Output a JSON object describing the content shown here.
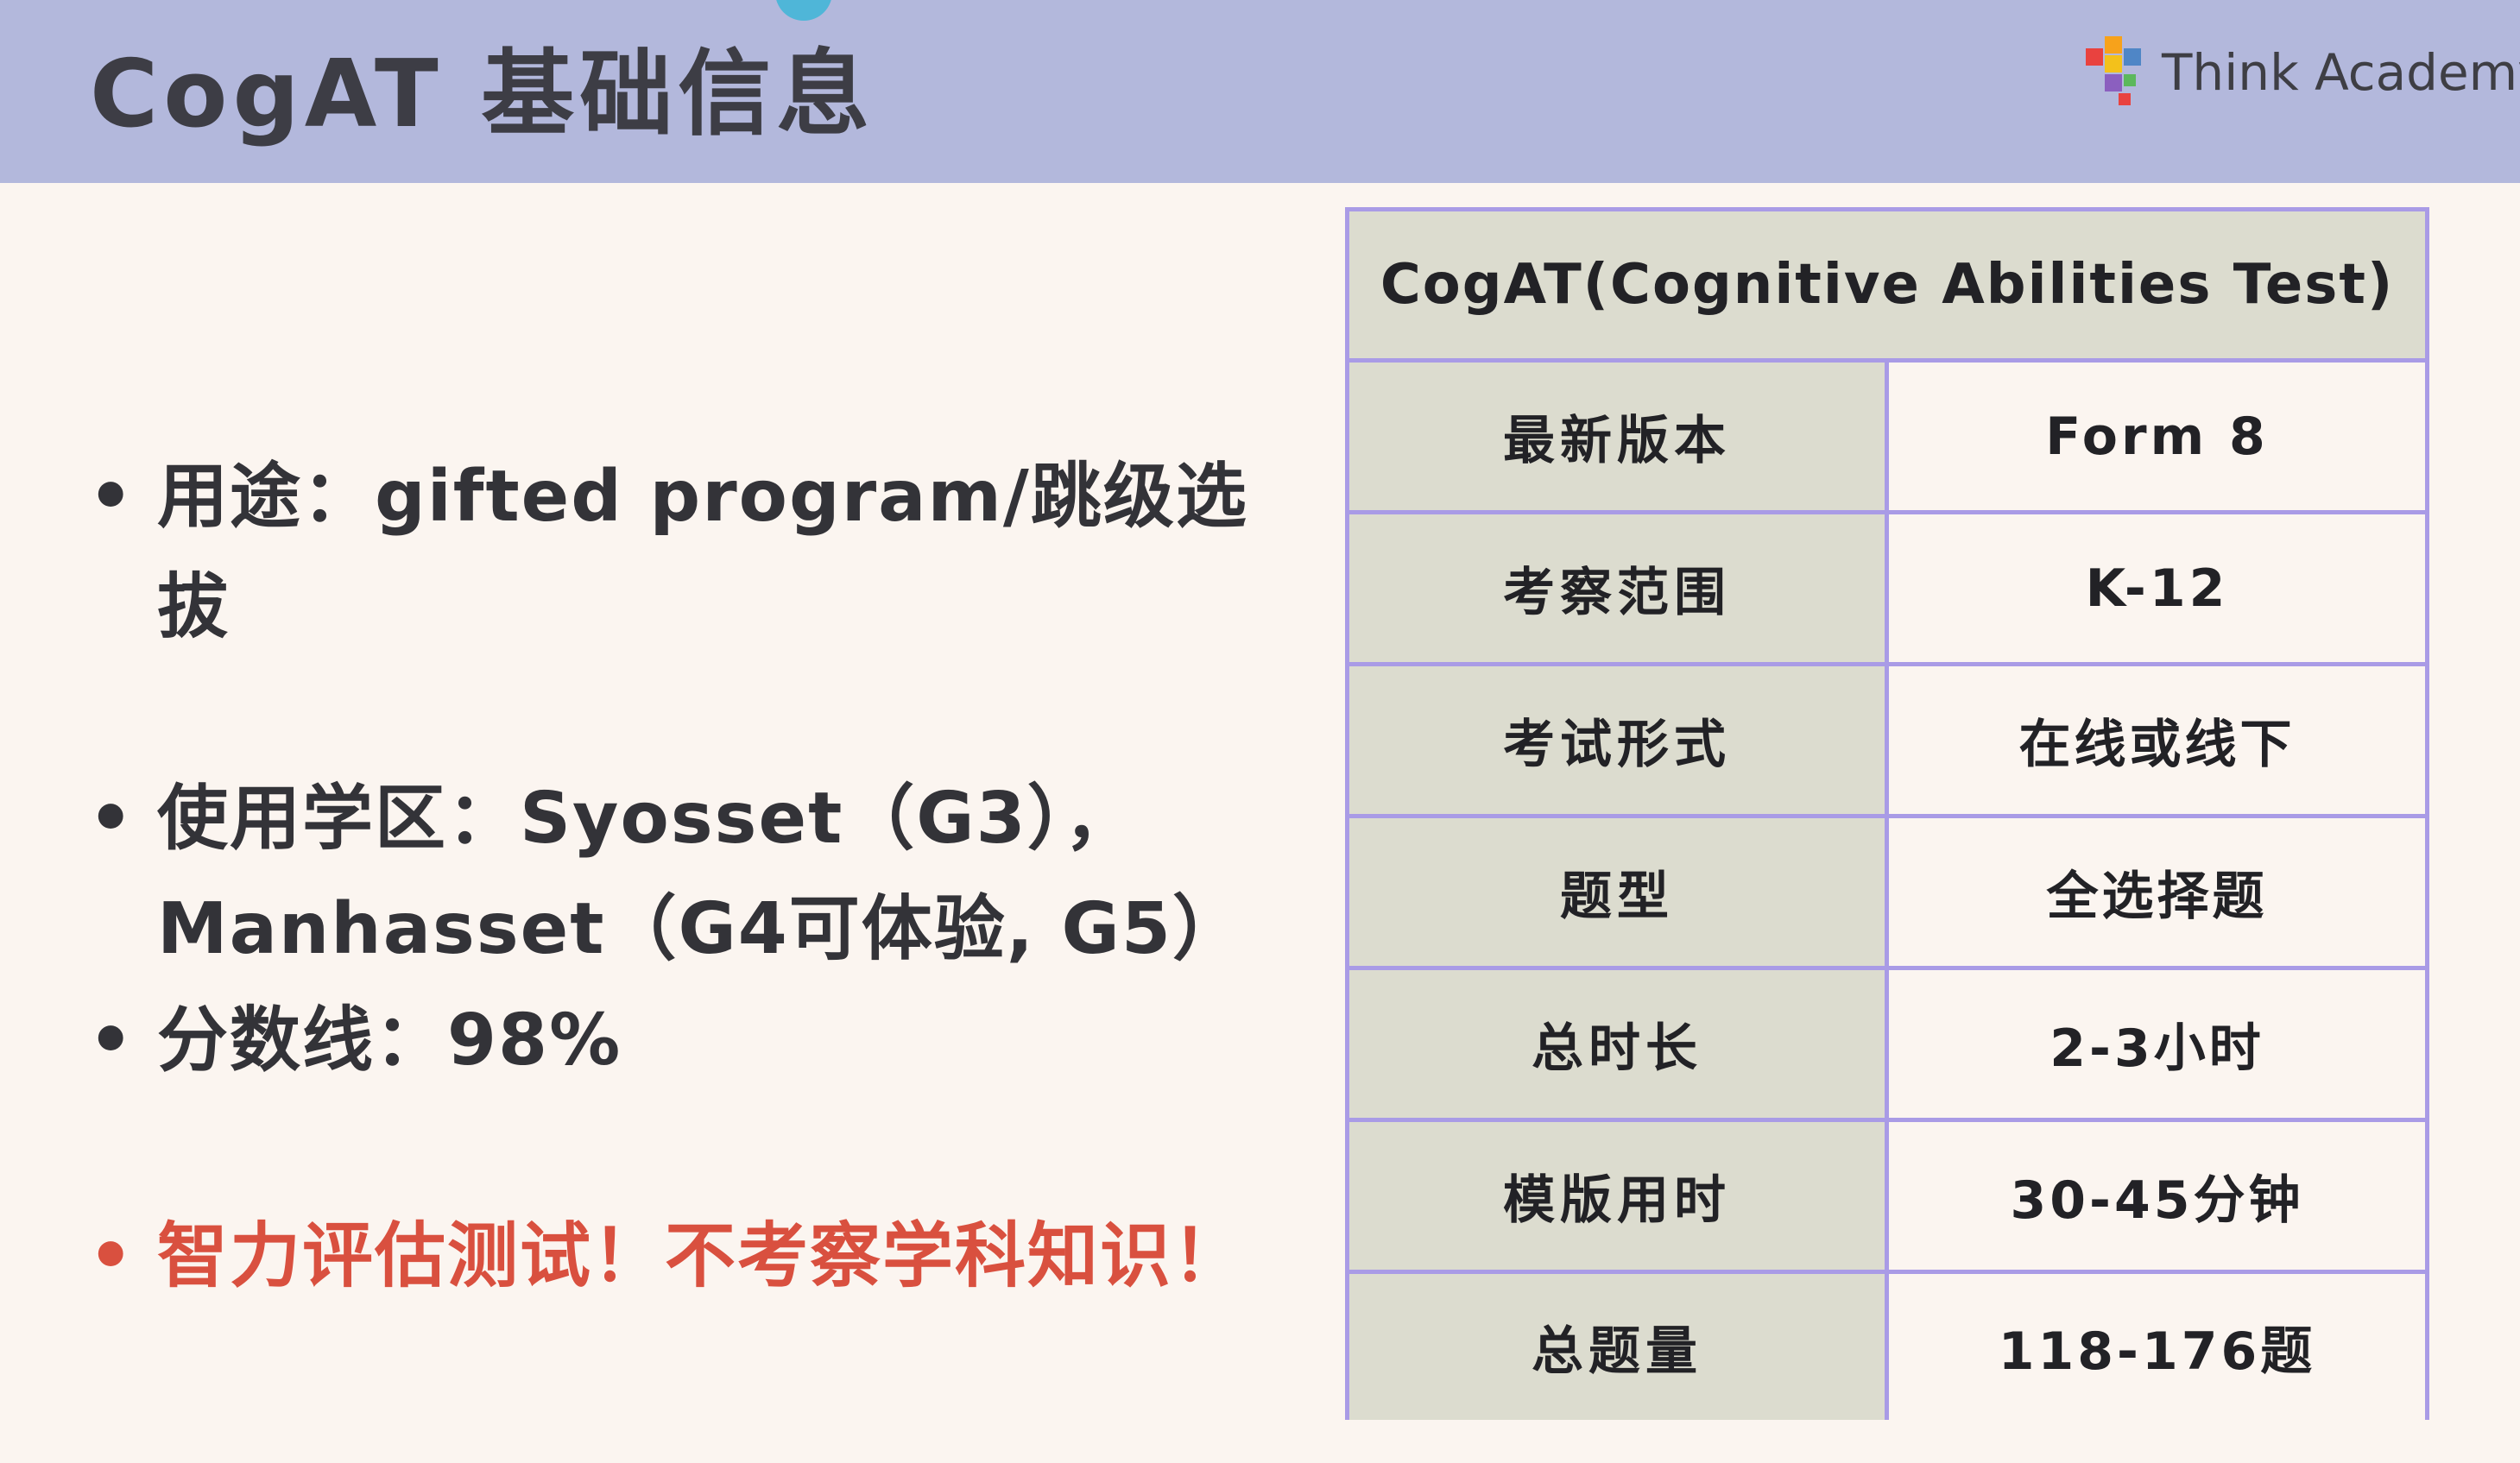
{
  "header": {
    "title": "CogAT 基础信息",
    "logo_text": "Think Academy",
    "logo_icon": "think-academy-logo-icon",
    "accent_color": "#b3b8dc"
  },
  "bullets": [
    {
      "text": "用途：gifted program/跳级选拔",
      "color": "#333338"
    },
    {
      "text": "使用学区：Syosset（G3），Manhasset（G4可体验, G5）",
      "color": "#333338"
    },
    {
      "text": "分数线：98%",
      "color": "#333338"
    },
    {
      "text": "智力评估测试！不考察学科知识！",
      "color": "#d9503f"
    }
  ],
  "table": {
    "header": "CogAT(Cognitive Abilities Test)",
    "rows": [
      {
        "key": "最新版本",
        "value": "Form 8"
      },
      {
        "key": "考察范围",
        "value": "K-12"
      },
      {
        "key": "考试形式",
        "value": "在线或线下"
      },
      {
        "key": "题型",
        "value": "全选择题"
      },
      {
        "key": "总时长",
        "value": "2-3小时"
      },
      {
        "key": "模版用时",
        "value": "30-45分钟"
      },
      {
        "key": "总题量",
        "value": "118-176题"
      }
    ],
    "border_color": "#a99be6",
    "key_bg": "#dcdccf"
  }
}
